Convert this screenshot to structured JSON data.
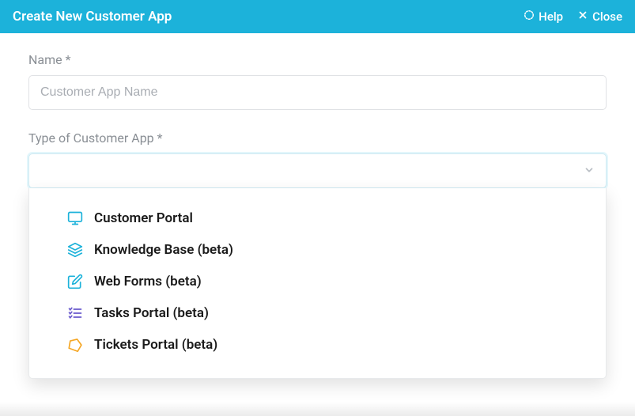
{
  "header": {
    "title": "Create New Customer App",
    "help_label": "Help",
    "close_label": "Close"
  },
  "form": {
    "name_label": "Name *",
    "name_placeholder": "Customer App Name",
    "type_label": "Type of Customer App *"
  },
  "dropdown": {
    "options": [
      {
        "icon": "monitor-icon",
        "label": "Customer Portal"
      },
      {
        "icon": "layers-icon",
        "label": "Knowledge Base (beta)"
      },
      {
        "icon": "edit-icon",
        "label": "Web Forms (beta)"
      },
      {
        "icon": "tasks-icon",
        "label": "Tasks Portal (beta)"
      },
      {
        "icon": "ticket-icon",
        "label": "Tickets Portal (beta)"
      }
    ]
  }
}
